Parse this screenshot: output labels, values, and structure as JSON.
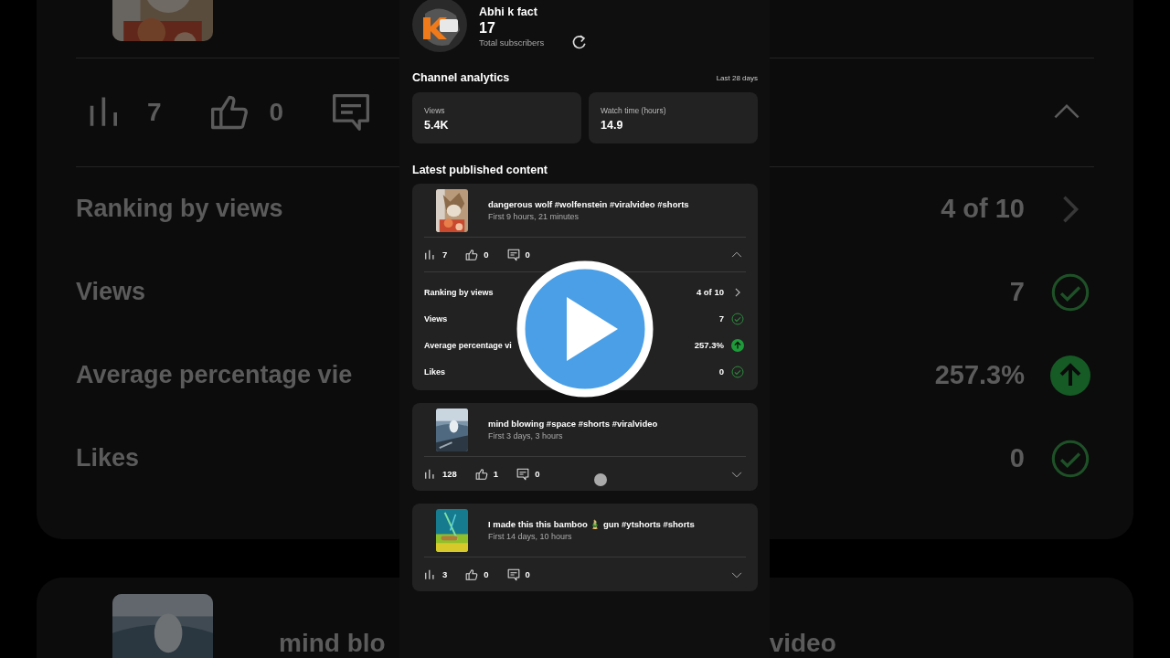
{
  "background": {
    "stats": [
      {
        "kind": "views",
        "value": "7"
      },
      {
        "kind": "likes",
        "value": "0"
      },
      {
        "kind": "comments"
      }
    ],
    "expanded": true,
    "metrics": [
      {
        "label": "Ranking by views",
        "value": "4 of 10",
        "kind": "chevron"
      },
      {
        "label": "Views",
        "value": "7",
        "kind": "check"
      },
      {
        "label": "Average percentage vie",
        "value": "257.3%",
        "kind": "up"
      },
      {
        "label": "Likes",
        "value": "0",
        "kind": "check"
      }
    ],
    "next_title_left": "mind blo",
    "next_title_right": "video"
  },
  "channel": {
    "name": "Abhi k fact",
    "subscribers": "17",
    "subscribers_label": "Total subscribers"
  },
  "analytics": {
    "title": "Channel analytics",
    "period": "Last 28 days",
    "cards": [
      {
        "label": "Views",
        "value": "5.4K"
      },
      {
        "label": "Watch time (hours)",
        "value": "14.9"
      }
    ]
  },
  "latest": {
    "title": "Latest published content",
    "videos": [
      {
        "title": "dangerous wolf #wolfenstein #viralvideo #shorts",
        "age": "First 9 hours, 21 minutes",
        "views": "7",
        "likes": "0",
        "comments": "0",
        "expanded": true,
        "metrics": [
          {
            "label": "Ranking by views",
            "value": "4 of 10",
            "kind": "chevron"
          },
          {
            "label": "Views",
            "value": "7",
            "kind": "check"
          },
          {
            "label": "Average percentage vi",
            "value": "257.3%",
            "kind": "up"
          },
          {
            "label": "Likes",
            "value": "0",
            "kind": "check"
          }
        ]
      },
      {
        "title": "mind blowing #space #shorts #viralvideo",
        "age": "First 3 days, 3 hours",
        "views": "128",
        "likes": "1",
        "comments": "0",
        "expanded": false
      },
      {
        "title": "I made this this bamboo 🎍 gun #ytshorts #shorts",
        "age": "First 14 days, 10 hours",
        "views": "3",
        "likes": "0",
        "comments": "0",
        "expanded": false
      }
    ]
  }
}
